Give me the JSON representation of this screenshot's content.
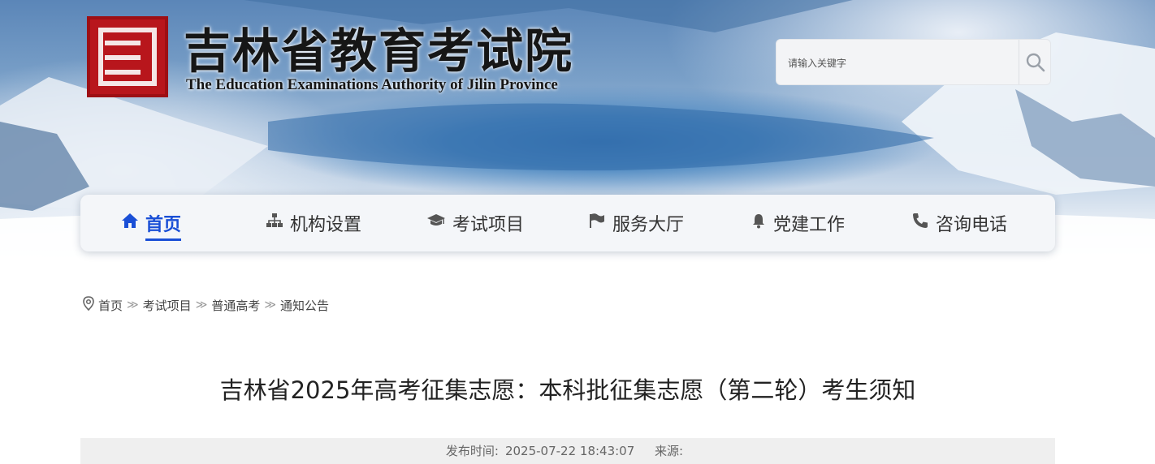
{
  "header": {
    "title": "吉林省教育考试院",
    "subtitle": "The Education Examinations Authority of Jilin Province",
    "logo_icon": "seal-logo-icon"
  },
  "search": {
    "placeholder": "请输入关键字",
    "value": "",
    "icon": "search-icon"
  },
  "nav": {
    "items": [
      {
        "label": "首页",
        "icon": "home-icon",
        "active": true
      },
      {
        "label": "机构设置",
        "icon": "org-chart-icon"
      },
      {
        "label": "考试项目",
        "icon": "graduation-cap-icon"
      },
      {
        "label": "服务大厅",
        "icon": "flag-icon"
      },
      {
        "label": "党建工作",
        "icon": "bell-icon"
      },
      {
        "label": "咨询电话",
        "icon": "phone-icon"
      }
    ]
  },
  "breadcrumb": {
    "icon": "location-pin-icon",
    "items": [
      "首页",
      "考试项目",
      "普通高考",
      "通知公告"
    ]
  },
  "article": {
    "title": "吉林省2025年高考征集志愿：本科批征集志愿（第二轮）考生须知",
    "publish_label": "发布时间:",
    "publish_time": "2025-07-22 18:43:07",
    "source_label": "来源:",
    "source_value": ""
  },
  "colors": {
    "accent": "#1a4fd6",
    "seal_red": "#b8161c",
    "nav_bg": "#f4f6f9",
    "meta_bg": "#efefef"
  }
}
